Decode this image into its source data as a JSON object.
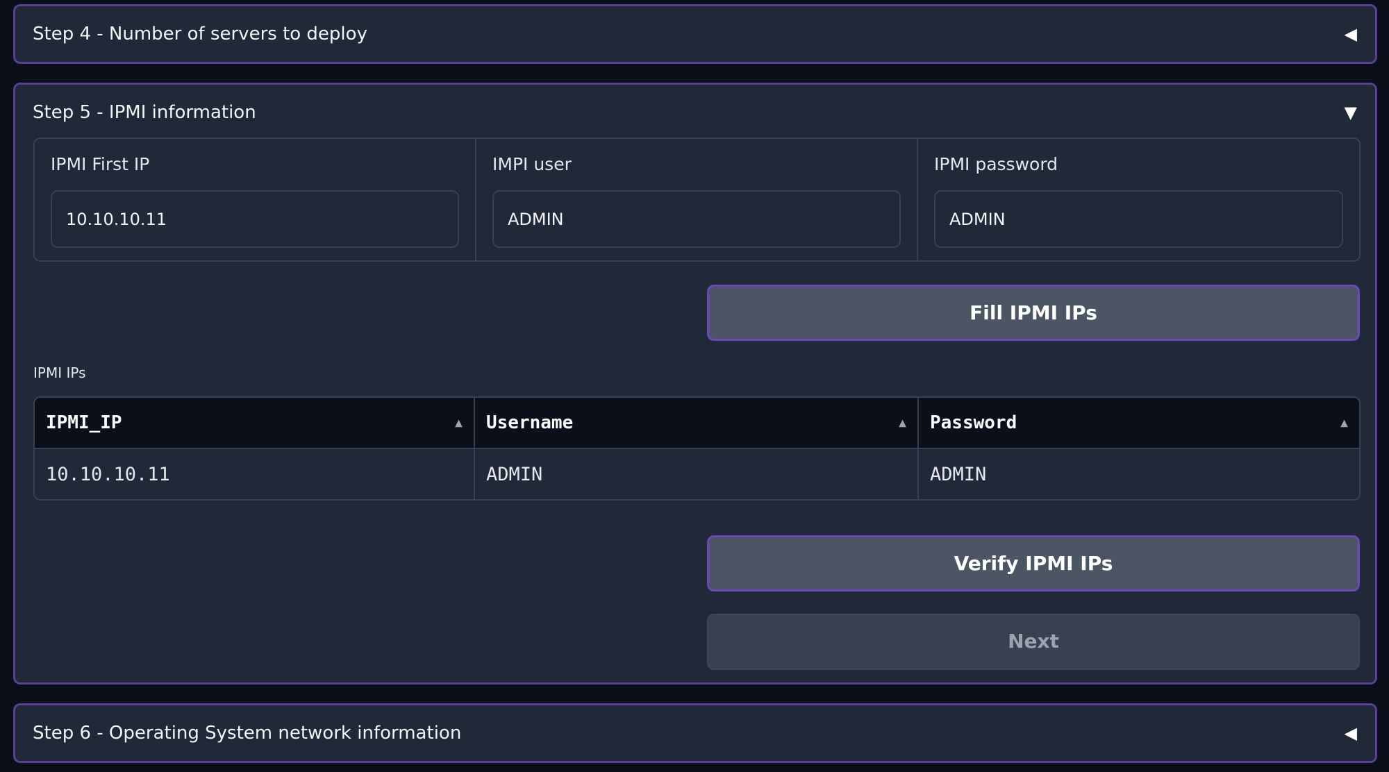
{
  "step4": {
    "title": "Step 4 - Number of servers to deploy",
    "arrow": "◀"
  },
  "step5": {
    "title": "Step 5 - IPMI information",
    "arrow": "▼",
    "fields": {
      "first_ip": {
        "label": "IPMI First IP",
        "value": "10.10.10.11"
      },
      "user": {
        "label": "IMPI user",
        "value": "ADMIN"
      },
      "password": {
        "label": "IPMI password",
        "value": "ADMIN"
      }
    },
    "fill_button": "Fill IPMI IPs",
    "table_label": "IPMI IPs",
    "table": {
      "headers": [
        "IPMI_IP",
        "Username",
        "Password"
      ],
      "sort_icon": "▲",
      "rows": [
        [
          "10.10.10.11",
          "ADMIN",
          "ADMIN"
        ]
      ]
    },
    "verify_button": "Verify IPMI IPs",
    "next_button": "Next"
  },
  "step6": {
    "title": "Step 6 - Operating System network information",
    "arrow": "◀"
  },
  "colors": {
    "background": "#0b0f19",
    "panel": "#1f2937",
    "accent_border": "#5b3f96",
    "button": "#4b5563"
  }
}
